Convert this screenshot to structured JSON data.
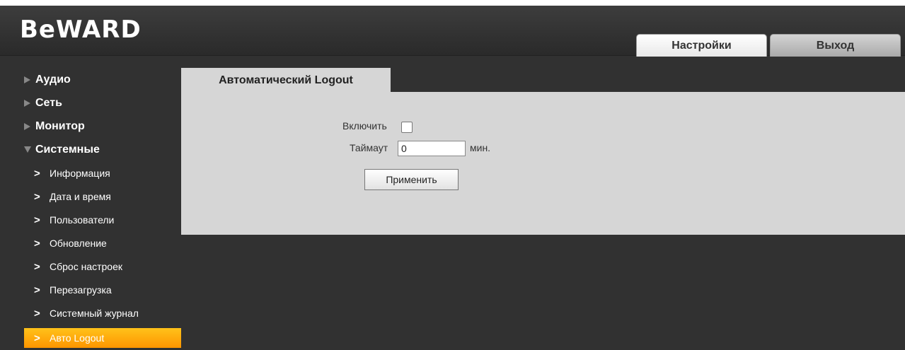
{
  "header": {
    "logo": "BeWARD",
    "tabs": [
      {
        "label": "Настройки",
        "active": true
      },
      {
        "label": "Выход",
        "active": false
      }
    ]
  },
  "sidebar": {
    "categories": [
      {
        "label": "Аудио",
        "expanded": false
      },
      {
        "label": "Сеть",
        "expanded": false
      },
      {
        "label": "Монитор",
        "expanded": false
      },
      {
        "label": "Системные",
        "expanded": true
      }
    ],
    "subitems": [
      {
        "label": "Информация",
        "active": false
      },
      {
        "label": "Дата и время",
        "active": false
      },
      {
        "label": "Пользователи",
        "active": false
      },
      {
        "label": "Обновление",
        "active": false
      },
      {
        "label": "Сброс настроек",
        "active": false
      },
      {
        "label": "Перезагрузка",
        "active": false
      },
      {
        "label": "Системный журнал",
        "active": false
      },
      {
        "label": "Авто Logout",
        "active": true
      }
    ],
    "chevron": ">"
  },
  "content": {
    "tab_title": "Автоматический Logout",
    "enable_label": "Включить",
    "enable_checked": false,
    "timeout_label": "Таймаут",
    "timeout_value": "0",
    "timeout_unit": "мин.",
    "apply_label": "Применить"
  },
  "colors": {
    "background": "#313131",
    "panel": "#d6d6d6",
    "active_item": "#ffa500"
  }
}
